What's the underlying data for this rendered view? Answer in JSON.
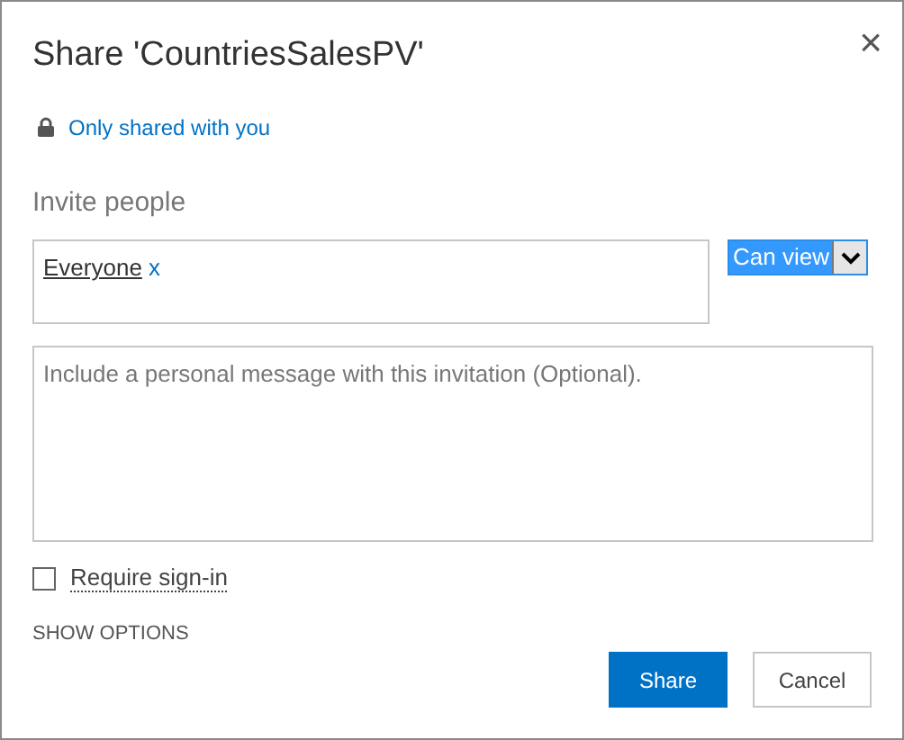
{
  "dialog": {
    "title": "Share 'CountriesSalesPV'",
    "close": "×"
  },
  "sharing_status": "Only shared with you",
  "invite": {
    "heading": "Invite people",
    "people": [
      {
        "name": "Everyone",
        "remove": "x"
      }
    ],
    "permission": {
      "value": "Can view",
      "selected": true
    }
  },
  "message": {
    "placeholder": "Include a personal message with this invitation (Optional)."
  },
  "require_sign_in": {
    "label": "Require sign-in",
    "checked": false
  },
  "show_options": "SHOW OPTIONS",
  "buttons": [
    {
      "label": "Share",
      "kind": "primary"
    },
    {
      "label": "Cancel",
      "kind": "secondary"
    }
  ]
}
